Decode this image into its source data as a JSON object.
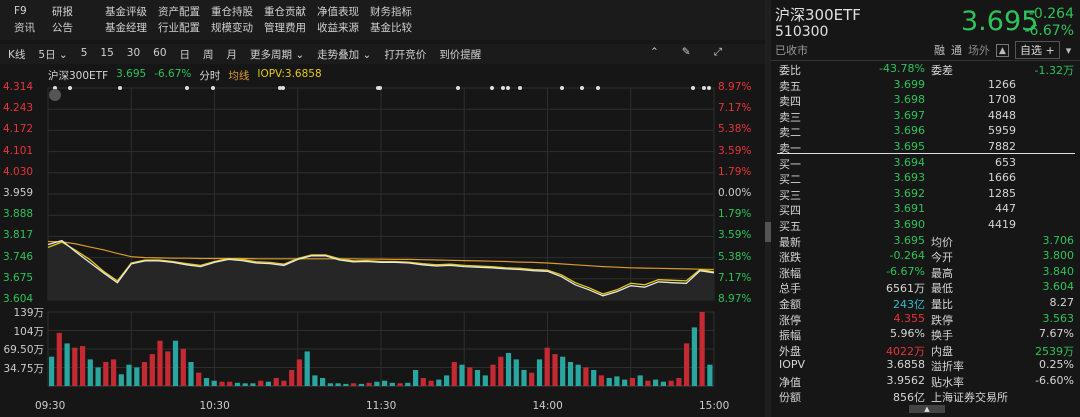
{
  "menu": {
    "row1": [
      "F9",
      "研报",
      "基金评级",
      "资产配置",
      "重仓持股",
      "重仓贡献",
      "净值表现",
      "财务指标"
    ],
    "row2": [
      "资讯",
      "公告",
      "基金经理",
      "行业配置",
      "规模变动",
      "管理费用",
      "收益来源",
      "基金比较"
    ]
  },
  "toolbar": {
    "items": [
      "K线",
      "5日 ⌄",
      "5",
      "15",
      "30",
      "60",
      "日",
      "周",
      "月",
      "更多周期 ⌄",
      "走势叠加 ⌄",
      "打开竞价",
      "到价提醒"
    ]
  },
  "chart_info": {
    "name": "沪深300ETF",
    "price": "3.695",
    "change_pct": "-6.67%",
    "mode": "分时",
    "avg_label": "均线",
    "iopv": "IOPV:3.6858"
  },
  "chart_data": {
    "type": "line",
    "price_axis": [
      "4.314",
      "4.243",
      "4.172",
      "4.101",
      "4.030",
      "3.959",
      "3.888",
      "3.817",
      "3.746",
      "3.675",
      "3.604"
    ],
    "pct_axis": [
      "8.97%",
      "7.17%",
      "5.38%",
      "3.59%",
      "1.79%",
      "0.00%",
      "1.79%",
      "3.59%",
      "5.38%",
      "7.17%",
      "8.97%"
    ],
    "ylim": [
      3.604,
      4.314
    ],
    "prev_close": 3.959,
    "time_labels": [
      "09:30",
      "10:30",
      "11:30",
      "14:00",
      "15:00"
    ],
    "minutes_total": 240,
    "price_step_min": 5,
    "price": [
      3.79,
      3.803,
      3.765,
      3.73,
      3.695,
      3.662,
      3.725,
      3.735,
      3.735,
      3.73,
      3.722,
      3.716,
      3.73,
      3.74,
      3.736,
      3.728,
      3.726,
      3.72,
      3.74,
      3.752,
      3.752,
      3.738,
      3.732,
      3.733,
      3.73,
      3.73,
      3.728,
      3.722,
      3.718,
      3.72,
      3.716,
      3.714,
      3.712,
      3.708,
      3.706,
      3.702,
      3.7,
      3.682,
      3.655,
      3.638,
      3.618,
      3.632,
      3.652,
      3.647,
      3.665,
      3.662,
      3.66,
      3.702,
      3.695
    ],
    "iopv": [
      3.78,
      3.798,
      3.77,
      3.74,
      3.7,
      3.668,
      3.728,
      3.738,
      3.738,
      3.733,
      3.726,
      3.72,
      3.733,
      3.743,
      3.74,
      3.732,
      3.73,
      3.724,
      3.743,
      3.755,
      3.755,
      3.742,
      3.735,
      3.736,
      3.733,
      3.733,
      3.731,
      3.726,
      3.722,
      3.724,
      3.72,
      3.718,
      3.716,
      3.712,
      3.71,
      3.706,
      3.704,
      3.688,
      3.662,
      3.645,
      3.624,
      3.638,
      3.66,
      3.655,
      3.672,
      3.67,
      3.668,
      3.706,
      3.698
    ],
    "avg": [
      3.8,
      3.799,
      3.792,
      3.782,
      3.772,
      3.76,
      3.749,
      3.746,
      3.745,
      3.744,
      3.744,
      3.743,
      3.743,
      3.743,
      3.743,
      3.742,
      3.742,
      3.742,
      3.742,
      3.742,
      3.742,
      3.742,
      3.742,
      3.741,
      3.741,
      3.74,
      3.74,
      3.739,
      3.738,
      3.737,
      3.736,
      3.735,
      3.734,
      3.733,
      3.731,
      3.73,
      3.728,
      3.725,
      3.722,
      3.719,
      3.716,
      3.714,
      3.712,
      3.711,
      3.71,
      3.709,
      3.708,
      3.707,
      3.706
    ],
    "volume_axis": [
      "139万",
      "104万",
      "69.50万",
      "34.75万"
    ],
    "volume_max": 139,
    "volume": [
      55,
      100,
      80,
      72,
      75,
      50,
      35,
      45,
      50,
      22,
      40,
      35,
      45,
      60,
      85,
      65,
      85,
      70,
      45,
      25,
      15,
      10,
      8,
      8,
      6,
      5,
      5,
      10,
      8,
      15,
      10,
      30,
      50,
      65,
      20,
      15,
      5,
      5,
      4,
      5,
      4,
      6,
      8,
      10,
      6,
      5,
      6,
      30,
      15,
      10,
      12,
      20,
      45,
      40,
      35,
      30,
      20,
      40,
      55,
      62,
      50,
      30,
      25,
      50,
      72,
      60,
      55,
      45,
      40,
      35,
      30,
      20,
      15,
      18,
      12,
      15,
      20,
      10,
      12,
      8,
      10,
      15,
      80,
      110,
      139,
      40
    ],
    "volume_dir": "grgrrggrrgggrrrrgrgrggrrgggrgrrrrggggggrgrgggrggrrggrgrggrrgggrgrrgggrgrgggrgrggrrrgr"
  },
  "quote": {
    "name": "沪深300ETF",
    "code": "510300",
    "status": "已收市",
    "price": "3.695",
    "change": "-0.264",
    "change_pct": "-6.67%",
    "tags": [
      "融",
      "通",
      "场外"
    ],
    "bell": "🔔",
    "watch": "自选 +",
    "drop": "▾"
  },
  "order_book": {
    "wb_label": "委比",
    "wb": "-43.78%",
    "wc_label": "委差",
    "wc": "-1.32万",
    "asks": [
      {
        "label": "卖五",
        "price": "3.699",
        "vol": "1266"
      },
      {
        "label": "卖四",
        "price": "3.698",
        "vol": "1708"
      },
      {
        "label": "卖三",
        "price": "3.697",
        "vol": "4848"
      },
      {
        "label": "卖二",
        "price": "3.696",
        "vol": "5959"
      },
      {
        "label": "卖一",
        "price": "3.695",
        "vol": "7882"
      }
    ],
    "bids": [
      {
        "label": "买一",
        "price": "3.694",
        "vol": "653"
      },
      {
        "label": "买二",
        "price": "3.693",
        "vol": "1666"
      },
      {
        "label": "买三",
        "price": "3.692",
        "vol": "1285"
      },
      {
        "label": "买四",
        "price": "3.691",
        "vol": "447"
      },
      {
        "label": "买五",
        "price": "3.690",
        "vol": "4419"
      }
    ]
  },
  "stats": [
    {
      "l1": "最新",
      "v1": "3.695",
      "c1": "g",
      "l2": "均价",
      "v2": "3.706",
      "c2": "g"
    },
    {
      "l1": "涨跌",
      "v1": "-0.264",
      "c1": "g",
      "l2": "今开",
      "v2": "3.800",
      "c2": "g"
    },
    {
      "l1": "涨幅",
      "v1": "-6.67%",
      "c1": "g",
      "l2": "最高",
      "v2": "3.840",
      "c2": "g"
    },
    {
      "l1": "总手",
      "v1": "6561万",
      "c1": "w",
      "l2": "最低",
      "v2": "3.604",
      "c2": "g"
    },
    {
      "l1": "金额",
      "v1": "243亿",
      "c1": "c",
      "l2": "量比",
      "v2": "8.27",
      "c2": "w"
    },
    {
      "l1": "涨停",
      "v1": "4.355",
      "c1": "r",
      "l2": "跌停",
      "v2": "3.563",
      "c2": "g"
    },
    {
      "l1": "振幅",
      "v1": "5.96%",
      "c1": "w",
      "l2": "换手",
      "v2": "7.67%",
      "c2": "w"
    },
    {
      "l1": "外盘",
      "v1": "4022万",
      "c1": "r",
      "l2": "内盘",
      "v2": "2539万",
      "c2": "g"
    },
    {
      "l1": "IOPV",
      "v1": "3.6858",
      "c1": "w",
      "l2": "溢折率",
      "v2": "0.25%",
      "c2": "w"
    },
    {
      "l1": "净值",
      "v1": "3.9562",
      "c1": "w",
      "l2": "贴水率",
      "v2": "-6.60%",
      "c2": "w"
    },
    {
      "l1": "份额",
      "v1": "856亿",
      "c1": "w",
      "l2": "上海证券交易所",
      "v2": "",
      "c2": "w"
    }
  ],
  "colors": {
    "up": "#e8333b",
    "down": "#2dc35a",
    "vol_up": "#c42a32",
    "vol_down": "#2aa6a0",
    "price_line": "#e8e8e8",
    "iopv_line": "#e5c912",
    "avg_line": "#d89a2c"
  }
}
